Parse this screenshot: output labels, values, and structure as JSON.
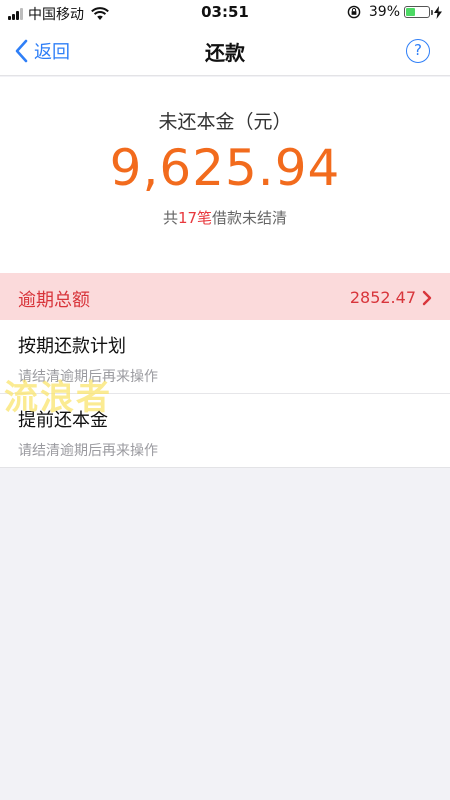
{
  "status_bar": {
    "carrier": "中国移动",
    "time": "03:51",
    "battery_percent_label": "39%",
    "battery_level": 0.39
  },
  "nav": {
    "back_label": "返回",
    "title": "还款",
    "help_label": "?"
  },
  "summary": {
    "label": "未还本金（元）",
    "amount": "9,625.94",
    "loans_prefix": "共",
    "loans_count": "17笔",
    "loans_suffix": "借款未结清"
  },
  "overdue": {
    "label": "逾期总额",
    "amount": "2852.47"
  },
  "plans": [
    {
      "title": "按期还款计划",
      "subtitle": "请结清逾期后再来操作"
    },
    {
      "title": "提前还本金",
      "subtitle": "请结清逾期后再来操作"
    }
  ],
  "watermark": "流浪者",
  "colors": {
    "accent_blue": "#2f7ff7",
    "amount_orange": "#f26b1d",
    "overdue_red": "#d8353b",
    "overdue_bg": "#fbdadb"
  }
}
